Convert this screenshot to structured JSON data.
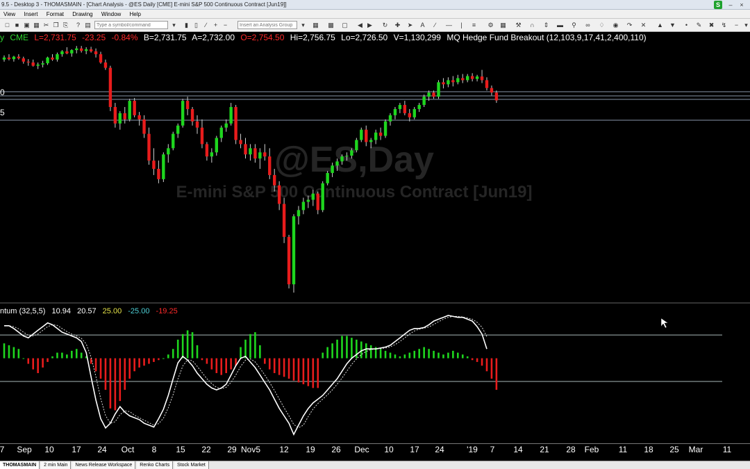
{
  "window": {
    "title": "9.5 - Desktop 3 - THOMASMAIN - [Chart Analysis - @ES Daily [CME] E-mini S&P 500 Continuous Contract [Jun19]]",
    "badge": "S"
  },
  "menu": [
    "View",
    "Insert",
    "Format",
    "Drawing",
    "Window",
    "Help"
  ],
  "toolbar": {
    "symbol_placeholder": "Type a symbol/command",
    "analysis_placeholder": "Insert an Analysis Group"
  },
  "quote": {
    "symbol": "y",
    "exchange": "CME",
    "last": "L=2,731.75",
    "change": "-23.25",
    "pct": "-0.84%",
    "bid": "B=2,731.75",
    "ask": "A=2,732.00",
    "open": "O=2,754.50",
    "high": "Hi=2,756.75",
    "low": "Lo=2,726.50",
    "volume": "V=1,130,299",
    "study": "MQ Hedge Fund Breakout (12,103,9,17,41,2,400,110)"
  },
  "watermark": {
    "symbol": "@ES,Day",
    "name": "E-mini S&P 500 Continuous Contract [Jun19]"
  },
  "price_labels": [
    "0",
    "5"
  ],
  "indicator": {
    "name": "ntum (32,5,5)",
    "v1": "10.94",
    "v2": "20.57",
    "v3": "25.00",
    "v4": "-25.00",
    "v5": "-19.25"
  },
  "xaxis": {
    "labels": [
      "7",
      "Sep",
      "10",
      "17",
      "24",
      "Oct",
      "8",
      "15",
      "22",
      "29",
      "Nov5",
      "12",
      "19",
      "26",
      "Dec",
      "10",
      "17",
      "24",
      "'19",
      "7",
      "14",
      "21",
      "28",
      "Feb",
      "11",
      "18",
      "25",
      "Mar",
      "11"
    ]
  },
  "tabs": [
    "THOMASMAIN",
    "2 min Main",
    "News Release Workspace",
    "Renko Charts",
    "Stock Market"
  ],
  "colors": {
    "up": "#1ed61e",
    "down": "#e81c1c",
    "line": "#ffffff",
    "level": "#7a8aa0",
    "watermark": "#2a2a2a"
  },
  "chart_data": {
    "type": "candlestick",
    "ohlc": [
      [
        2905,
        2915,
        2900,
        2910
      ],
      [
        2910,
        2918,
        2903,
        2906
      ],
      [
        2906,
        2914,
        2900,
        2912
      ],
      [
        2912,
        2918,
        2905,
        2908
      ],
      [
        2908,
        2912,
        2895,
        2900
      ],
      [
        2900,
        2906,
        2890,
        2898
      ],
      [
        2898,
        2905,
        2888,
        2890
      ],
      [
        2890,
        2898,
        2882,
        2893
      ],
      [
        2893,
        2902,
        2886,
        2896
      ],
      [
        2896,
        2912,
        2892,
        2910
      ],
      [
        2910,
        2918,
        2902,
        2905
      ],
      [
        2905,
        2922,
        2900,
        2918
      ],
      [
        2918,
        2928,
        2912,
        2925
      ],
      [
        2925,
        2935,
        2918,
        2920
      ],
      [
        2920,
        2930,
        2912,
        2928
      ],
      [
        2928,
        2938,
        2920,
        2932
      ],
      [
        2932,
        2938,
        2922,
        2926
      ],
      [
        2926,
        2935,
        2918,
        2930
      ],
      [
        2930,
        2936,
        2922,
        2925
      ],
      [
        2925,
        2932,
        2910,
        2918
      ],
      [
        2918,
        2924,
        2895,
        2898
      ],
      [
        2898,
        2905,
        2880,
        2885
      ],
      [
        2885,
        2890,
        2780,
        2790
      ],
      [
        2790,
        2800,
        2740,
        2750
      ],
      [
        2750,
        2780,
        2735,
        2775
      ],
      [
        2775,
        2790,
        2750,
        2760
      ],
      [
        2760,
        2810,
        2755,
        2805
      ],
      [
        2805,
        2812,
        2765,
        2770
      ],
      [
        2770,
        2778,
        2745,
        2760
      ],
      [
        2760,
        2770,
        2715,
        2725
      ],
      [
        2725,
        2740,
        2650,
        2660
      ],
      [
        2660,
        2690,
        2625,
        2640
      ],
      [
        2640,
        2660,
        2605,
        2615
      ],
      [
        2615,
        2680,
        2608,
        2675
      ],
      [
        2675,
        2700,
        2655,
        2690
      ],
      [
        2690,
        2730,
        2685,
        2725
      ],
      [
        2725,
        2750,
        2715,
        2745
      ],
      [
        2745,
        2810,
        2740,
        2805
      ],
      [
        2805,
        2815,
        2770,
        2785
      ],
      [
        2785,
        2790,
        2745,
        2755
      ],
      [
        2755,
        2770,
        2725,
        2740
      ],
      [
        2740,
        2760,
        2690,
        2700
      ],
      [
        2700,
        2705,
        2660,
        2670
      ],
      [
        2670,
        2690,
        2655,
        2680
      ],
      [
        2680,
        2720,
        2672,
        2715
      ],
      [
        2715,
        2745,
        2705,
        2740
      ],
      [
        2740,
        2760,
        2730,
        2750
      ],
      [
        2750,
        2800,
        2745,
        2790
      ],
      [
        2790,
        2795,
        2700,
        2710
      ],
      [
        2710,
        2725,
        2690,
        2700
      ],
      [
        2700,
        2715,
        2665,
        2675
      ],
      [
        2675,
        2700,
        2660,
        2690
      ],
      [
        2690,
        2700,
        2655,
        2665
      ],
      [
        2665,
        2690,
        2640,
        2680
      ],
      [
        2680,
        2700,
        2660,
        2670
      ],
      [
        2670,
        2690,
        2615,
        2625
      ],
      [
        2625,
        2640,
        2585,
        2600
      ],
      [
        2600,
        2610,
        2540,
        2555
      ],
      [
        2555,
        2570,
        2460,
        2475
      ],
      [
        2475,
        2480,
        2350,
        2360
      ],
      [
        2360,
        2530,
        2340,
        2525
      ],
      [
        2525,
        2550,
        2505,
        2540
      ],
      [
        2540,
        2570,
        2530,
        2560
      ],
      [
        2560,
        2575,
        2545,
        2565
      ],
      [
        2565,
        2590,
        2550,
        2580
      ],
      [
        2580,
        2585,
        2530,
        2540
      ],
      [
        2540,
        2610,
        2535,
        2605
      ],
      [
        2605,
        2635,
        2600,
        2630
      ],
      [
        2630,
        2655,
        2620,
        2648
      ],
      [
        2648,
        2665,
        2635,
        2658
      ],
      [
        2658,
        2675,
        2650,
        2670
      ],
      [
        2670,
        2680,
        2660,
        2672
      ],
      [
        2672,
        2690,
        2665,
        2685
      ],
      [
        2685,
        2715,
        2680,
        2710
      ],
      [
        2710,
        2740,
        2705,
        2735
      ],
      [
        2735,
        2745,
        2695,
        2705
      ],
      [
        2705,
        2715,
        2690,
        2710
      ],
      [
        2710,
        2735,
        2700,
        2728
      ],
      [
        2728,
        2740,
        2710,
        2720
      ],
      [
        2720,
        2760,
        2715,
        2755
      ],
      [
        2755,
        2775,
        2745,
        2770
      ],
      [
        2770,
        2790,
        2760,
        2785
      ],
      [
        2785,
        2800,
        2775,
        2795
      ],
      [
        2795,
        2805,
        2770,
        2775
      ],
      [
        2775,
        2785,
        2755,
        2765
      ],
      [
        2765,
        2790,
        2760,
        2785
      ],
      [
        2785,
        2800,
        2778,
        2795
      ],
      [
        2795,
        2820,
        2790,
        2815
      ],
      [
        2815,
        2830,
        2805,
        2825
      ],
      [
        2825,
        2830,
        2810,
        2815
      ],
      [
        2815,
        2855,
        2810,
        2850
      ],
      [
        2850,
        2860,
        2835,
        2845
      ],
      [
        2845,
        2862,
        2838,
        2855
      ],
      [
        2855,
        2865,
        2840,
        2850
      ],
      [
        2850,
        2868,
        2845,
        2860
      ],
      [
        2860,
        2870,
        2848,
        2855
      ],
      [
        2855,
        2870,
        2850,
        2865
      ],
      [
        2865,
        2872,
        2852,
        2858
      ],
      [
        2858,
        2868,
        2852,
        2864
      ],
      [
        2864,
        2880,
        2848,
        2855
      ],
      [
        2855,
        2862,
        2830,
        2836
      ],
      [
        2836,
        2842,
        2818,
        2825
      ],
      [
        2825,
        2830,
        2800,
        2806
      ]
    ],
    "oscillator": [
      35,
      35,
      32,
      28,
      24,
      22,
      26,
      30,
      34,
      38,
      36,
      32,
      28,
      26,
      24,
      22,
      18,
      6,
      -20,
      -45,
      -65,
      -75,
      -70,
      -60,
      -52,
      -58,
      -62,
      -64,
      -66,
      -70,
      -72,
      -74,
      -65,
      -55,
      -40,
      -22,
      -5,
      2,
      -2,
      -8,
      -16,
      -22,
      -28,
      -32,
      -34,
      -32,
      -28,
      -18,
      -8,
      0,
      2,
      -4,
      -10,
      -18,
      -26,
      -34,
      -44,
      -54,
      -62,
      -70,
      -82,
      -72,
      -62,
      -54,
      -48,
      -44,
      -40,
      -34,
      -28,
      -22,
      -14,
      -6,
      0,
      4,
      8,
      10,
      10,
      10,
      11,
      12,
      14,
      18,
      22,
      26,
      30,
      32,
      32,
      33,
      36,
      40,
      42,
      44,
      46,
      45,
      44,
      44,
      42,
      40,
      34,
      26,
      10
    ],
    "histogram": [
      16,
      14,
      12,
      10,
      0,
      -6,
      -12,
      -16,
      -10,
      -4,
      2,
      6,
      6,
      4,
      8,
      10,
      6,
      2,
      -6,
      -14,
      -22,
      -34,
      -54,
      -56,
      -46,
      -34,
      -22,
      -14,
      -10,
      -8,
      -6,
      -4,
      -2,
      0,
      4,
      10,
      20,
      26,
      30,
      28,
      14,
      -2,
      -6,
      -12,
      -16,
      -18,
      -16,
      -12,
      -8,
      12,
      20,
      26,
      28,
      14,
      -6,
      -12,
      -16,
      -18,
      -20,
      -22,
      -24,
      -26,
      -28,
      -30,
      -32,
      -32,
      6,
      12,
      16,
      20,
      24,
      24,
      22,
      20,
      18,
      16,
      14,
      12,
      10,
      8,
      6,
      4,
      2,
      4,
      6,
      8,
      10,
      12,
      10,
      8,
      6,
      4,
      6,
      8,
      6,
      4,
      2,
      -2,
      -4,
      -8,
      -14,
      -22,
      -34
    ],
    "levels": {
      "osc_upper": 25,
      "osc_lower": -25
    }
  }
}
